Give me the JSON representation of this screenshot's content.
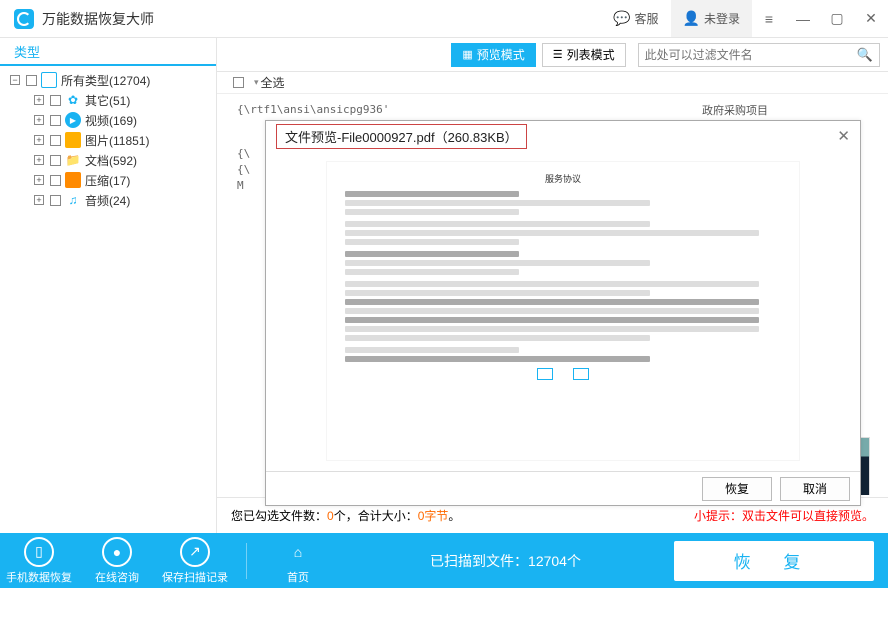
{
  "titlebar": {
    "app_name": "万能数据恢复大师",
    "support_label": "客服",
    "login_label": "未登录"
  },
  "sidebar": {
    "tab_label": "类型",
    "root_label": "所有类型(12704)",
    "items": [
      {
        "label": "其它(51)",
        "icon": "gear"
      },
      {
        "label": "视频(169)",
        "icon": "video"
      },
      {
        "label": "图片(11851)",
        "icon": "image"
      },
      {
        "label": "文档(592)",
        "icon": "doc"
      },
      {
        "label": "压缩(17)",
        "icon": "zip"
      },
      {
        "label": "音频(24)",
        "icon": "audio"
      }
    ]
  },
  "toolbar": {
    "preview_mode": "预览模式",
    "list_mode": "列表模式",
    "search_placeholder": "此处可以过滤文件名",
    "select_all": "全选"
  },
  "background": {
    "line1": "{\\rtf1\\ansi\\ansicpg936'",
    "line2": "{\\",
    "line3": "{\\",
    "line4": "M",
    "header_right": "政府采购项目"
  },
  "modal": {
    "title": "文件预览-File0000927.pdf（260.83KB）",
    "recover": "恢复",
    "cancel": "取消",
    "doc_header": "服务协议"
  },
  "status": {
    "prefix": "您已勾选文件数：",
    "count": "0",
    "mid": "个，合计大小：",
    "size": "0字节",
    "suffix": "。",
    "tip": "小提示：双击文件可以直接预览。"
  },
  "actionbar": {
    "phone_recover": "手机数据恢复",
    "online_consult": "在线咨询",
    "save_scan": "保存扫描记录",
    "home": "首页",
    "scanned_prefix": "已扫描到文件：",
    "scanned_count": "12704",
    "scanned_suffix": "个",
    "recover_btn": "恢 复"
  }
}
